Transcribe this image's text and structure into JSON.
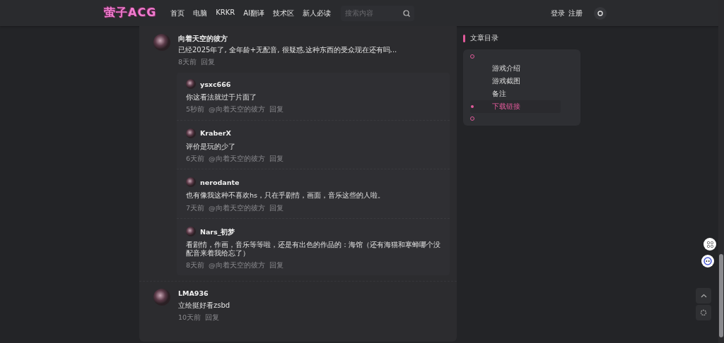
{
  "header": {
    "logo": "萤子ACG",
    "nav": [
      "首页",
      "电脑",
      "KRKR",
      "AI翻译",
      "技术区",
      "新人必读"
    ],
    "search": {
      "placeholder": "搜索内容"
    },
    "login": "登录",
    "register": "注册"
  },
  "comments": [
    {
      "author": "向着天空的彼方",
      "text": "已经2025年了, 全年龄+无配音, 很疑惑,这种东西的受众现在还有吗...",
      "time": "8天前",
      "reply": "回复",
      "replies": [
        {
          "author": "ysxc666",
          "text": "你这看法就过于片面了",
          "time": "5秒前",
          "mention": "@向着天空的彼方",
          "reply": "回复"
        },
        {
          "author": "KraberX",
          "text": "评价是玩的少了",
          "time": "6天前",
          "mention": "@向着天空的彼方",
          "reply": "回复"
        },
        {
          "author": "nerodante",
          "text": "也有像我这种不喜欢hs，只在乎剧情，画面，音乐这些的人啦。",
          "time": "7天前",
          "mention": "@向着天空的彼方",
          "reply": "回复"
        },
        {
          "author": "Nars_初梦",
          "text": "看剧情，作画，音乐等等啦，还是有出色的作品的：海馆（还有海猫和寒蝉哪个没配音来着我给忘了）",
          "time": "8天前",
          "mention": "@向着天空的彼方",
          "reply": "回复"
        }
      ]
    },
    {
      "author": "LMA936",
      "text": "立绘挺好看zsbd",
      "time": "10天前",
      "reply": "回复"
    }
  ],
  "toc": {
    "title": "文章目录",
    "items": [
      {
        "label": "游戏介绍",
        "selected": false
      },
      {
        "label": "游戏截图",
        "selected": false
      },
      {
        "label": "备注",
        "selected": false
      },
      {
        "label": "下载链接",
        "selected": true
      }
    ]
  }
}
